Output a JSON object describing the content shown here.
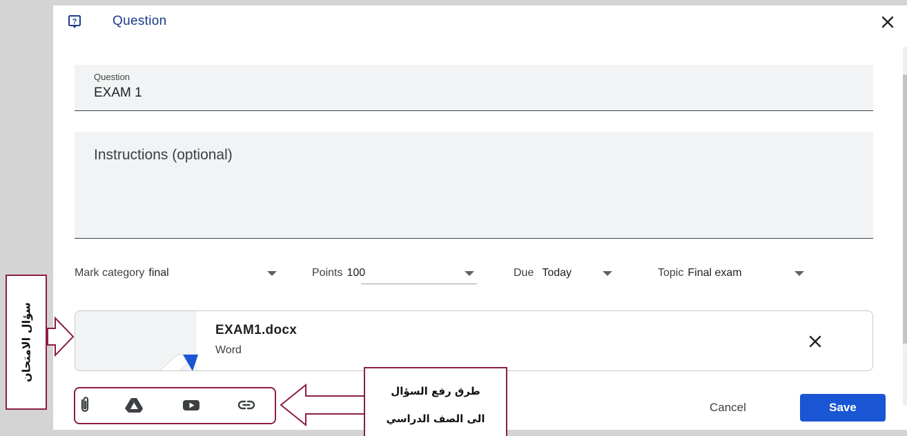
{
  "dialog": {
    "title": "Question"
  },
  "question_field": {
    "label": "Question",
    "value": "EXAM 1"
  },
  "instructions_field": {
    "placeholder": "Instructions (optional)"
  },
  "options": {
    "mark_category": {
      "label": "Mark category",
      "value": "final"
    },
    "points": {
      "label": "Points",
      "value": "100"
    },
    "due": {
      "label": "Due",
      "value": "Today"
    },
    "topic": {
      "label": "Topic",
      "value": "Final exam"
    }
  },
  "attachment": {
    "name": "EXAM1.docx",
    "type": "Word"
  },
  "toolbar": {
    "icons": [
      "paperclip-icon",
      "google-drive-icon",
      "youtube-icon",
      "link-icon"
    ]
  },
  "actions": {
    "cancel": "Cancel",
    "save": "Save"
  },
  "annotations": {
    "exam_question": "سؤال الامتحان",
    "upload_methods_line1": "طرق رفع السؤال",
    "upload_methods_line2": "الى الصف الدراسي"
  },
  "colors": {
    "accent": "#1a55d4",
    "title": "#1a3a8a",
    "annotation_border": "#8b1e3f"
  }
}
